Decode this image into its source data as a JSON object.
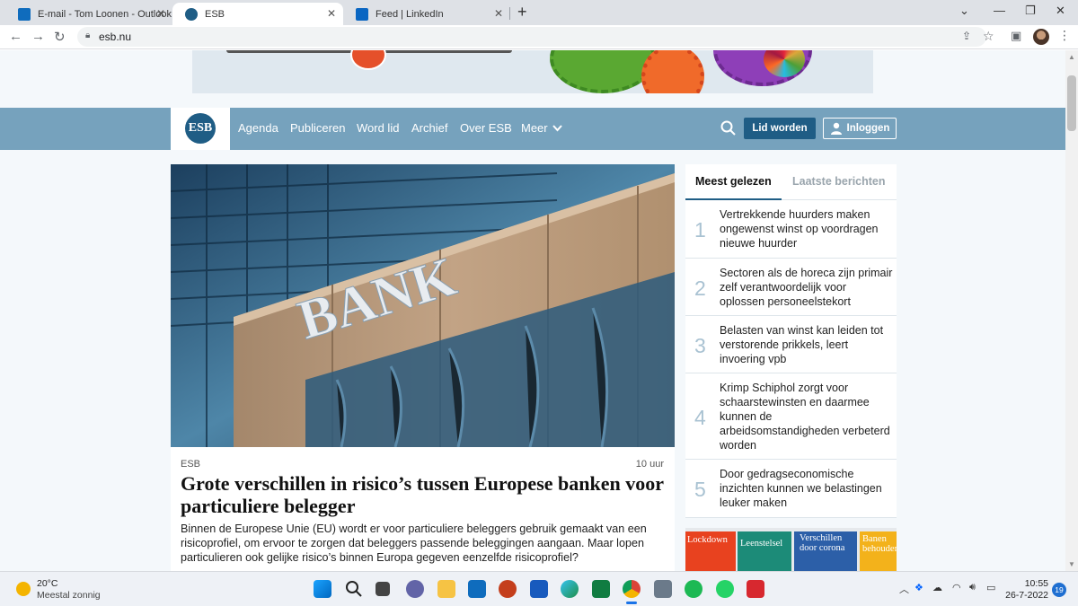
{
  "browser": {
    "tabs": [
      {
        "title": "E-mail - Tom Loonen - Outlook",
        "icon": "outlook-icon",
        "color": "#0f6cbd"
      },
      {
        "title": "ESB",
        "icon": "esb-icon",
        "color": "#1f5d85"
      },
      {
        "title": "Feed | LinkedIn",
        "icon": "linkedin-icon",
        "color": "#0a66c2"
      }
    ],
    "url": "esb.nu"
  },
  "site": {
    "logo_text": "ESB",
    "nav": [
      "Agenda",
      "Publiceren",
      "Word lid",
      "Archief",
      "Over ESB",
      "Meer"
    ],
    "cta_member": "Lid worden",
    "cta_login": "Inloggen",
    "nav_color": "#76a2bd",
    "accent_color": "#1f5d85"
  },
  "hero": {
    "image_text": "BANK",
    "category": "ESB",
    "time": "10 uur",
    "title": "Grote verschillen in risico’s tussen Europese banken voor particuliere belegger",
    "lead": "Binnen de Europese Unie (EU) wordt er voor particuliere beleggers gebruik gemaakt van een risicoprofiel, om ervoor te zorgen dat beleggers passende beleggingen aangaan. Maar lopen particulieren ook gelijke risico’s binnen Europa gegeven eenzelfde risicoprofiel?"
  },
  "sidebar": {
    "tab_active": "Meest gelezen",
    "tab_inactive": "Laatste berichten",
    "items": [
      {
        "num": "1",
        "text": "Vertrekkende huurders maken ongewenst winst op voordragen nieuwe huurder"
      },
      {
        "num": "2",
        "text": "Sectoren als de horeca zijn primair zelf verantwoordelijk voor oplossen personeelstekort"
      },
      {
        "num": "3",
        "text": "Belasten van winst kan leiden tot verstorende prikkels, leert invoering vpb"
      },
      {
        "num": "4",
        "text": "Krimp Schiphol zorgt voor schaarstewinsten en daarmee kunnen de arbeidsomstandigheden verbeterd worden"
      },
      {
        "num": "5",
        "text": "Door gedragseconomische inzichten kunnen we belastingen leuker maken"
      }
    ],
    "magazines": [
      "Lockdown",
      "Leenstelsel",
      "Verschillen door corona",
      "Banen behouden"
    ]
  },
  "taskbar": {
    "temp": "20°C",
    "weather": "Meestal zonnig",
    "time": "10:55",
    "date": "26-7-2022",
    "notifications": "19"
  }
}
